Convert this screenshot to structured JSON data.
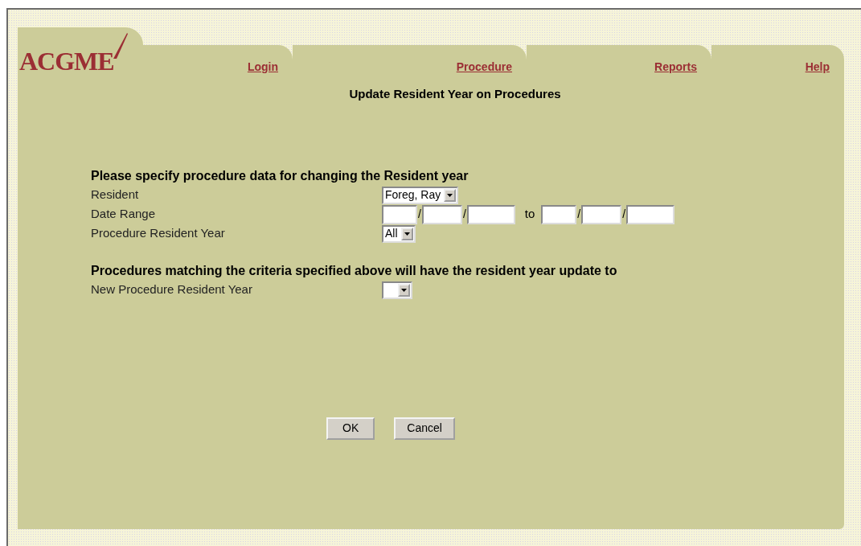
{
  "logo": {
    "text": "ACGME"
  },
  "tabs": [
    {
      "label": "Login"
    },
    {
      "label": "Procedure"
    },
    {
      "label": "Reports"
    },
    {
      "label": "Help"
    }
  ],
  "page_title": "Update Resident Year on Procedures",
  "sections": [
    {
      "heading": "Please specify procedure data for changing the Resident year",
      "fields": [
        {
          "kind": "select",
          "label": "Resident",
          "value": "Foreg, Ray"
        },
        {
          "kind": "date_range",
          "label": "Date Range",
          "start_separators": [
            "/",
            "/"
          ],
          "joiner": "to",
          "end_separators": [
            "/",
            "/"
          ]
        },
        {
          "kind": "select",
          "label": "Procedure Resident Year",
          "value": "All"
        }
      ]
    },
    {
      "heading": "Procedures matching the criteria specified above will have the resident year update to",
      "fields": [
        {
          "kind": "select",
          "label": "New Procedure Resident Year"
        }
      ]
    }
  ],
  "buttons": [
    "OK",
    "Cancel"
  ]
}
